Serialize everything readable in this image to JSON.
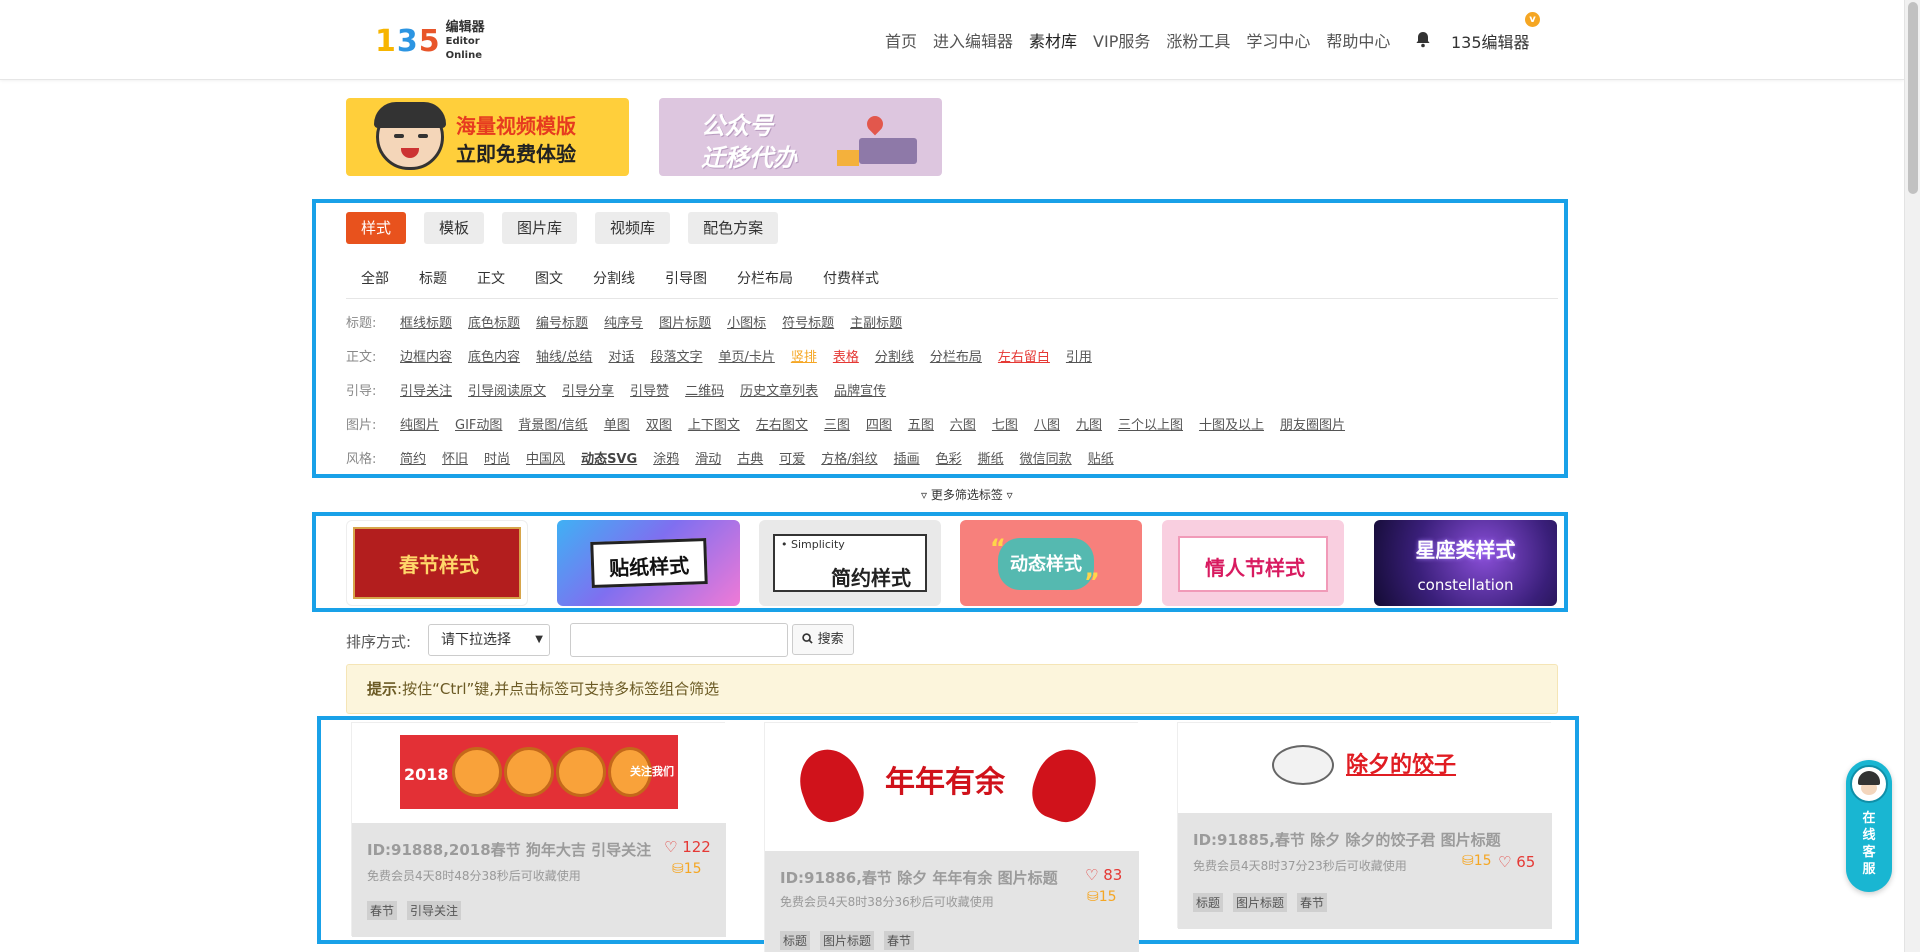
{
  "header": {
    "logo": {
      "mark": "135",
      "cn": "编辑器",
      "en": "Editor Online"
    },
    "nav": [
      {
        "label": "首页"
      },
      {
        "label": "进入编辑器"
      },
      {
        "label": "素材库"
      },
      {
        "label": "VIP服务"
      },
      {
        "label": "涨粉工具"
      },
      {
        "label": "学习中心"
      },
      {
        "label": "帮助中心"
      }
    ],
    "user_name": "135编辑器",
    "vip_badge": "v"
  },
  "banners": [
    {
      "line1": "海量视频模版",
      "line2": "立即免费体验"
    },
    {
      "line1": "公众号",
      "line2": "迁移代办"
    }
  ],
  "main_tabs": [
    "样式",
    "模板",
    "图片库",
    "视频库",
    "配色方案"
  ],
  "active_main_tab": "样式",
  "sub_tabs": [
    "全部",
    "标题",
    "正文",
    "图文",
    "分割线",
    "引导图",
    "分栏布局",
    "付费样式"
  ],
  "filters": [
    {
      "label": "标题:",
      "tags": [
        "框线标题",
        "底色标题",
        "编号标题",
        "纯序号",
        "图片标题",
        "小图标",
        "符号标题",
        "主副标题"
      ]
    },
    {
      "label": "正文:",
      "tags": [
        "边框内容",
        "底色内容",
        "轴线/总结",
        "对话",
        "段落文字",
        "单页/卡片",
        "竖排",
        "表格",
        "分割线",
        "分栏布局",
        "左右留白",
        "引用"
      ]
    },
    {
      "label": "引导:",
      "tags": [
        "引导关注",
        "引导阅读原文",
        "引导分享",
        "引导赞",
        "二维码",
        "历史文章列表",
        "品牌宣传"
      ]
    },
    {
      "label": "图片:",
      "tags": [
        "纯图片",
        "GIF动图",
        "背景图/信纸",
        "单图",
        "双图",
        "上下图文",
        "左右图文",
        "三图",
        "四图",
        "五图",
        "六图",
        "七图",
        "八图",
        "九图",
        "三个以上图",
        "十图及以上",
        "朋友圈图片"
      ]
    },
    {
      "label": "风格:",
      "tags": [
        "简约",
        "怀旧",
        "时尚",
        "中国风",
        "动态SVG",
        "涂鸦",
        "滑动",
        "古典",
        "可爱",
        "方格/斜纹",
        "插画",
        "色彩",
        "撕纸",
        "微信同款",
        "贴纸"
      ]
    }
  ],
  "more_filters": "▿ 更多筛选标签 ▿",
  "categories": [
    {
      "label": "春节样式"
    },
    {
      "label": "贴纸样式"
    },
    {
      "label": "简约样式",
      "sub": "• Simplicity"
    },
    {
      "label": "动态样式"
    },
    {
      "label": "情人节样式"
    },
    {
      "label": "星座类样式",
      "sub": "constellation"
    }
  ],
  "sort": {
    "label": "排序方式:",
    "select_value": "请下拉选择",
    "search_placeholder": "",
    "search_button": "搜索"
  },
  "tip": {
    "bold": "提示",
    "text": ":按住“Ctrl”键,并点击标签可支持多标签组合筛选"
  },
  "cards": [
    {
      "title": "ID:91888,2018春节 狗年大吉 引导关注",
      "likes": "122",
      "coins": "15",
      "member": "免费会员4天8时48分38秒后可收藏使用",
      "tags": [
        "春节",
        "引导关注"
      ],
      "art_year": "2018",
      "art_follow": "关注我们"
    },
    {
      "title": "ID:91886,春节 除夕 年年有余 图片标题",
      "likes": "83",
      "coins": "15",
      "member": "免费会员4天8时38分36秒后可收藏使用",
      "tags": [
        "标题",
        "图片标题",
        "春节"
      ],
      "art_text": "年年有余"
    },
    {
      "title": "ID:91885,春节 除夕 除夕的饺子君 图片标题",
      "likes": "65",
      "coins": "15",
      "member": "免费会员4天8时37分23秒后可收藏使用",
      "tags": [
        "标题",
        "图片标题",
        "春节"
      ],
      "art_text": "除夕的饺子"
    }
  ],
  "chat_widget": {
    "text": "在线客服"
  },
  "colors": {
    "accent": "#e8521d",
    "annotation_frame": "#19a1e8",
    "like": "#e53935",
    "coin": "#f5a623",
    "chat": "#19b6d2"
  }
}
